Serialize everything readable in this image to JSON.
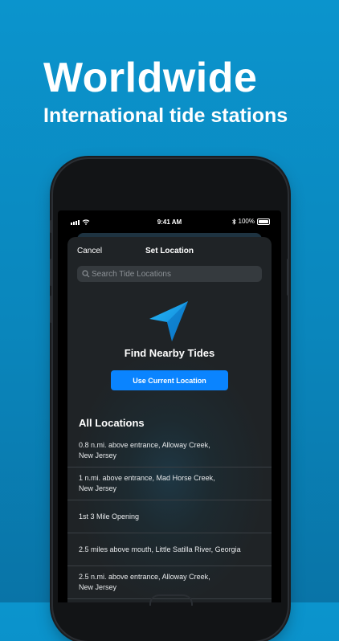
{
  "promo": {
    "headline": "Worldwide",
    "subheadline": "International tide stations"
  },
  "status_bar": {
    "time": "9:41 AM",
    "battery": "100%",
    "bluetooth_icon": "bluetooth-icon",
    "wifi_icon": "wifi-icon"
  },
  "nav": {
    "cancel": "Cancel",
    "title": "Set Location"
  },
  "search": {
    "placeholder": "Search Tide Locations",
    "value": ""
  },
  "nearby": {
    "title": "Find Nearby Tides",
    "button": "Use Current Location",
    "icon": "location-arrow-icon"
  },
  "locations": {
    "title": "All Locations",
    "items": [
      {
        "line1": "0.8 n.mi. above entrance, Alloway Creek,",
        "line2": "New Jersey"
      },
      {
        "line1": "1 n.mi. above entrance, Mad Horse Creek,",
        "line2": "New Jersey"
      },
      {
        "line1": "1st 3 Mile Opening",
        "line2": ""
      },
      {
        "line1": "2.5 miles above mouth, Little Satilla River, Georgia",
        "line2": ""
      },
      {
        "line1": "2.5 n.mi. above entrance, Alloway Creek,",
        "line2": "New Jersey"
      }
    ]
  },
  "colors": {
    "background": "#0b94cd",
    "accent": "#0a84ff",
    "sheet": "#1f2326"
  }
}
